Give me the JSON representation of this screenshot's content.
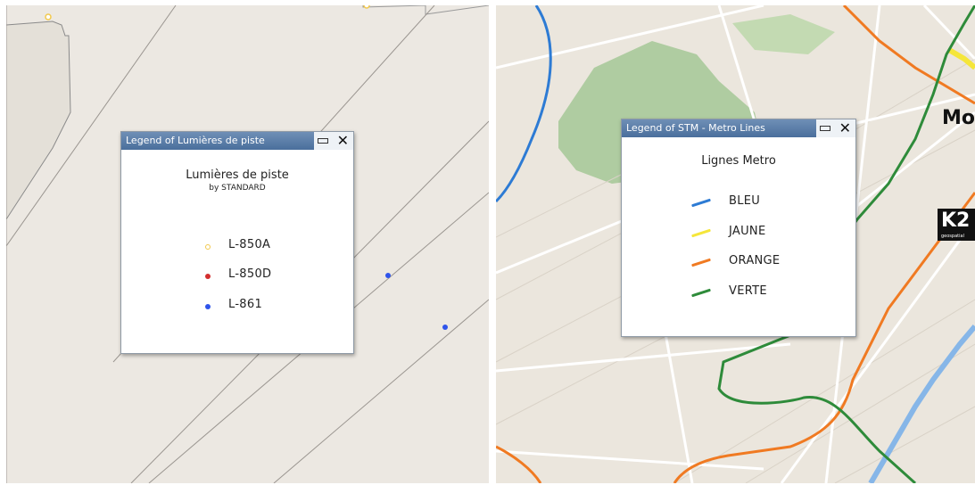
{
  "left_map": {
    "legend": {
      "window_title": "Legend of Lumières de piste",
      "title": "Lumières de piste",
      "subtitle": "by STANDARD",
      "items": [
        {
          "label": "L-850A",
          "color": "#f2c94c",
          "symbol": "ring"
        },
        {
          "label": "L-850D",
          "color": "#d32f2f",
          "symbol": "dot"
        },
        {
          "label": "L-861",
          "color": "#2f54eb",
          "symbol": "dot"
        }
      ]
    }
  },
  "right_map": {
    "place_label": "Mo",
    "badge": {
      "text": "K2",
      "sub": "geospatial"
    },
    "legend": {
      "window_title": "Legend of STM - Metro Lines",
      "title": "Lignes Metro",
      "items": [
        {
          "label": "BLEU",
          "color": "#2d7bd4"
        },
        {
          "label": "JAUNE",
          "color": "#f5e63a"
        },
        {
          "label": "ORANGE",
          "color": "#f07a22"
        },
        {
          "label": "VERTE",
          "color": "#2e8b3a"
        }
      ]
    }
  }
}
